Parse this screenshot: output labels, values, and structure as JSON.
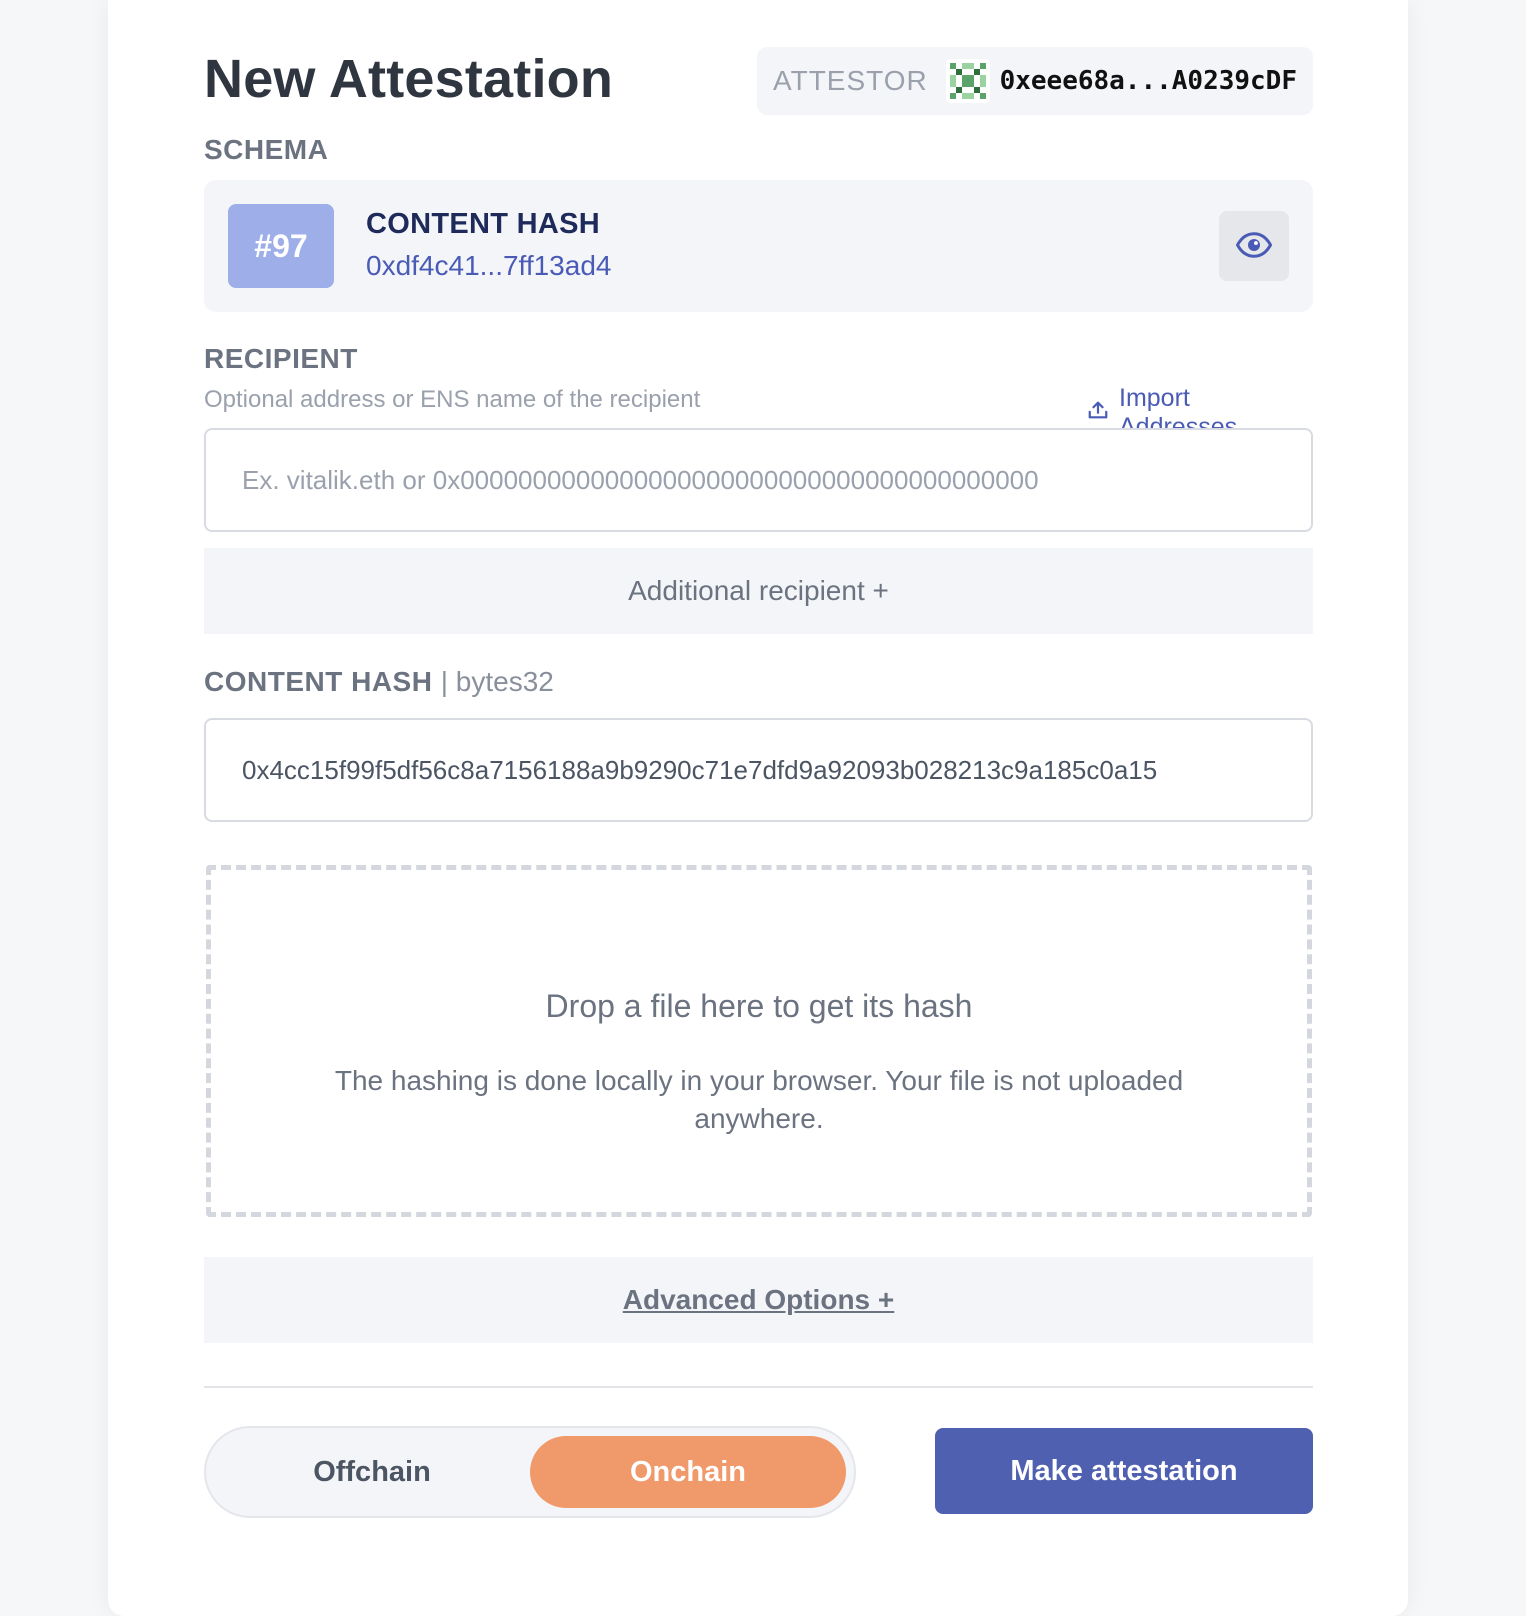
{
  "page": {
    "title": "New Attestation"
  },
  "attestor": {
    "label": "ATTESTOR",
    "address": "0xeee68a...A0239cDF",
    "avatar_icon": "identicon-icon"
  },
  "schema": {
    "section_label": "SCHEMA",
    "badge": "#97",
    "name": "CONTENT HASH",
    "uid": "0xdf4c41...7ff13ad4",
    "view_icon": "eye-icon"
  },
  "recipient": {
    "section_label": "RECIPIENT",
    "help_text": "Optional address or ENS name of the recipient",
    "import_label": "Import Addresses",
    "import_icon": "upload-icon",
    "placeholder": "Ex. vitalik.eth or 0x0000000000000000000000000000000000000000",
    "value": "",
    "additional_label": "Additional recipient +"
  },
  "content_hash": {
    "field_name": "CONTENT HASH",
    "type_tag": "| bytes32",
    "value": "0x4cc15f99f5df56c8a7156188a9b9290c71e7dfd9a92093b028213c9a185c0a15"
  },
  "dropzone": {
    "title": "Drop a file here to get its hash",
    "note": "The hashing is done locally in your browser. Your file is not uploaded anywhere."
  },
  "advanced": {
    "label": "Advanced Options +"
  },
  "mode": {
    "offchain_label": "Offchain",
    "onchain_label": "Onchain",
    "selected": "Onchain"
  },
  "submit": {
    "label": "Make attestation"
  },
  "colors": {
    "accent": "#5060b0",
    "badge": "#9daee8",
    "onchain": "#f0996b",
    "link": "#4a5bb5"
  }
}
